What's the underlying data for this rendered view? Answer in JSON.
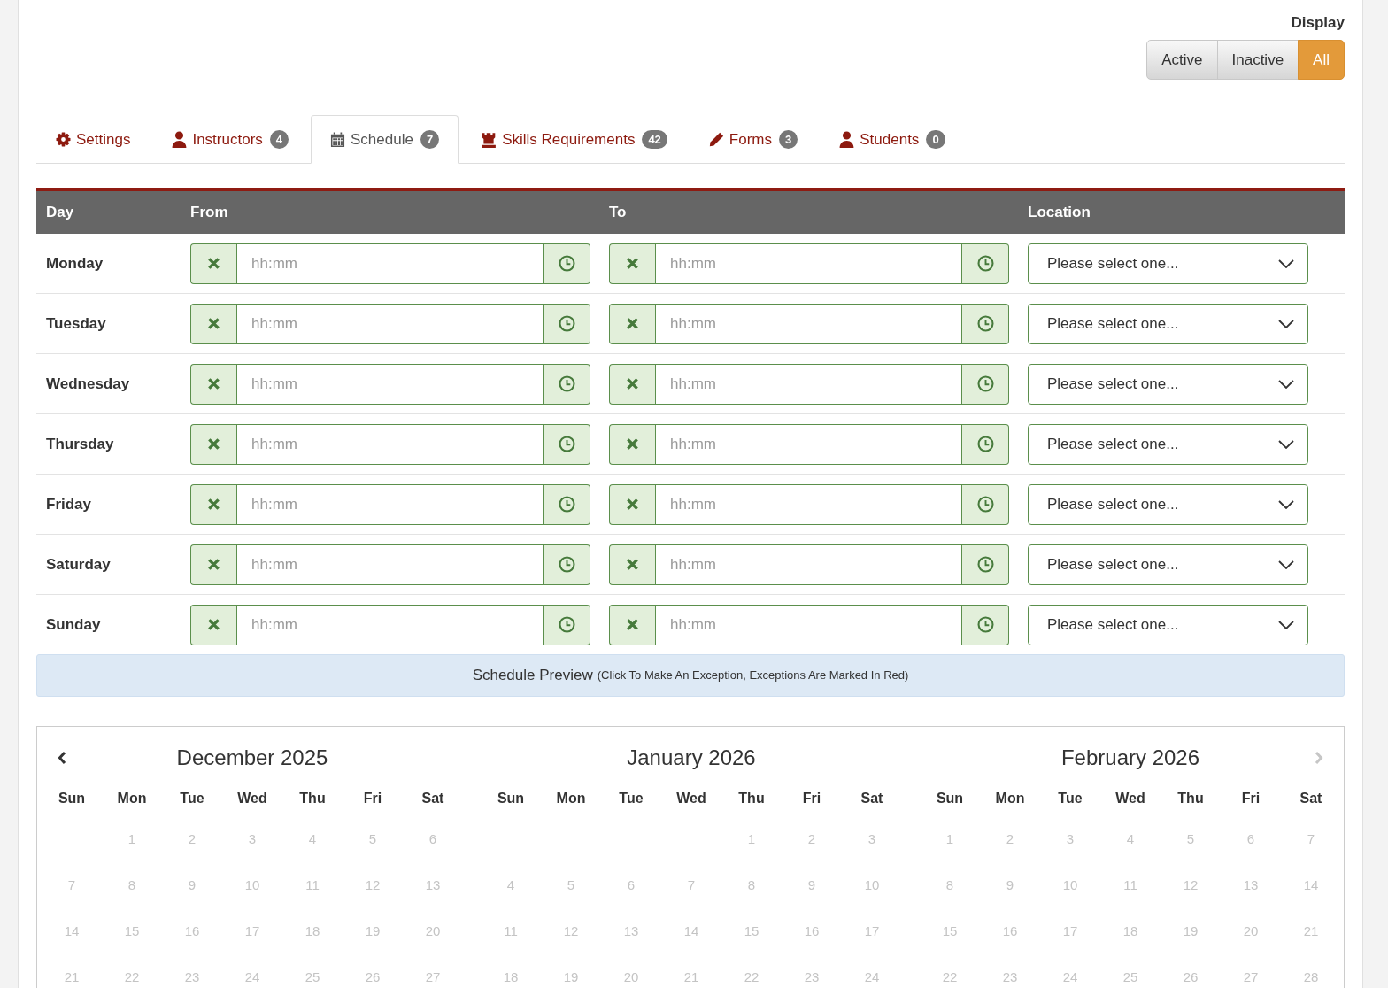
{
  "display": {
    "label": "Display",
    "options": [
      {
        "label": "Active",
        "selected": false
      },
      {
        "label": "Inactive",
        "selected": false
      },
      {
        "label": "All",
        "selected": true
      }
    ]
  },
  "tabs": [
    {
      "label": "Settings",
      "selected": false
    },
    {
      "label": "Instructors",
      "count": "4",
      "selected": false
    },
    {
      "label": "Schedule",
      "count": "7",
      "selected": true
    },
    {
      "label": "Skills Requirements",
      "count": "42",
      "selected": false
    },
    {
      "label": "Forms",
      "count": "3",
      "selected": false
    },
    {
      "label": "Students",
      "count": "0",
      "selected": false
    }
  ],
  "schedule": {
    "columns": [
      "Day",
      "From",
      "To",
      "Location"
    ],
    "rows": [
      {
        "day": "Monday",
        "from": {
          "placeholder": "hh:mm"
        },
        "to": {
          "placeholder": "hh:mm"
        },
        "location": "Please select one..."
      },
      {
        "day": "Tuesday",
        "from": {
          "placeholder": "hh:mm"
        },
        "to": {
          "placeholder": "hh:mm"
        },
        "location": "Please select one..."
      },
      {
        "day": "Wednesday",
        "from": {
          "placeholder": "hh:mm"
        },
        "to": {
          "placeholder": "hh:mm"
        },
        "location": "Please select one..."
      },
      {
        "day": "Thursday",
        "from": {
          "placeholder": "hh:mm"
        },
        "to": {
          "placeholder": "hh:mm"
        },
        "location": "Please select one..."
      },
      {
        "day": "Friday",
        "from": {
          "placeholder": "hh:mm"
        },
        "to": {
          "placeholder": "hh:mm"
        },
        "location": "Please select one..."
      },
      {
        "day": "Saturday",
        "from": {
          "placeholder": "hh:mm"
        },
        "to": {
          "placeholder": "hh:mm"
        },
        "location": "Please select one..."
      },
      {
        "day": "Sunday",
        "from": {
          "placeholder": "hh:mm"
        },
        "to": {
          "placeholder": "hh:mm"
        },
        "location": "Please select one..."
      }
    ]
  },
  "preview": {
    "title": "Schedule Preview",
    "note": "(Click To Make An Exception, Exceptions Are Marked In Red)"
  },
  "calendar": {
    "previous": {
      "disabled": false
    },
    "next": {
      "disabled": true
    },
    "months": [
      {
        "title": "December 2025",
        "weekdays": [
          "Sun",
          "Mon",
          "Tue",
          "Wed",
          "Thu",
          "Fri",
          "Sat"
        ],
        "weeks": [
          [
            {
              "kind": "blank"
            },
            {
              "kind": "day",
              "text": "1"
            },
            {
              "kind": "day",
              "text": "2"
            },
            {
              "kind": "day",
              "text": "3"
            },
            {
              "kind": "day",
              "text": "4"
            },
            {
              "kind": "day",
              "text": "5"
            },
            {
              "kind": "day",
              "text": "6"
            }
          ],
          [
            {
              "kind": "day",
              "text": "7"
            },
            {
              "kind": "day",
              "text": "8"
            },
            {
              "kind": "day",
              "text": "9"
            },
            {
              "kind": "day",
              "text": "10"
            },
            {
              "kind": "day",
              "text": "11"
            },
            {
              "kind": "day",
              "text": "12"
            },
            {
              "kind": "day",
              "text": "13"
            }
          ],
          [
            {
              "kind": "day",
              "text": "14"
            },
            {
              "kind": "day",
              "text": "15"
            },
            {
              "kind": "day",
              "text": "16"
            },
            {
              "kind": "day",
              "text": "17"
            },
            {
              "kind": "day",
              "text": "18"
            },
            {
              "kind": "day",
              "text": "19"
            },
            {
              "kind": "day",
              "text": "20"
            }
          ],
          [
            {
              "kind": "day",
              "text": "21"
            },
            {
              "kind": "day",
              "text": "22"
            },
            {
              "kind": "day",
              "text": "23"
            },
            {
              "kind": "day",
              "text": "24"
            },
            {
              "kind": "day",
              "text": "25"
            },
            {
              "kind": "day",
              "text": "26"
            },
            {
              "kind": "day",
              "text": "27"
            }
          ]
        ]
      },
      {
        "title": "January 2026",
        "weekdays": [
          "Sun",
          "Mon",
          "Tue",
          "Wed",
          "Thu",
          "Fri",
          "Sat"
        ],
        "weeks": [
          [
            {
              "kind": "blank"
            },
            {
              "kind": "blank"
            },
            {
              "kind": "blank"
            },
            {
              "kind": "blank"
            },
            {
              "kind": "day",
              "text": "1"
            },
            {
              "kind": "day",
              "text": "2"
            },
            {
              "kind": "day",
              "text": "3"
            }
          ],
          [
            {
              "kind": "day",
              "text": "4"
            },
            {
              "kind": "day",
              "text": "5"
            },
            {
              "kind": "day",
              "text": "6"
            },
            {
              "kind": "day",
              "text": "7"
            },
            {
              "kind": "day",
              "text": "8"
            },
            {
              "kind": "day",
              "text": "9"
            },
            {
              "kind": "day",
              "text": "10"
            }
          ],
          [
            {
              "kind": "day",
              "text": "11"
            },
            {
              "kind": "day",
              "text": "12"
            },
            {
              "kind": "day",
              "text": "13"
            },
            {
              "kind": "day",
              "text": "14"
            },
            {
              "kind": "day",
              "text": "15"
            },
            {
              "kind": "day",
              "text": "16"
            },
            {
              "kind": "day",
              "text": "17"
            }
          ],
          [
            {
              "kind": "day",
              "text": "18"
            },
            {
              "kind": "day",
              "text": "19"
            },
            {
              "kind": "day",
              "text": "20"
            },
            {
              "kind": "day",
              "text": "21"
            },
            {
              "kind": "day",
              "text": "22"
            },
            {
              "kind": "day",
              "text": "23"
            },
            {
              "kind": "day",
              "text": "24"
            }
          ]
        ]
      },
      {
        "title": "February 2026",
        "weekdays": [
          "Sun",
          "Mon",
          "Tue",
          "Wed",
          "Thu",
          "Fri",
          "Sat"
        ],
        "weeks": [
          [
            {
              "kind": "day",
              "text": "1"
            },
            {
              "kind": "day",
              "text": "2"
            },
            {
              "kind": "day",
              "text": "3"
            },
            {
              "kind": "day",
              "text": "4"
            },
            {
              "kind": "day",
              "text": "5"
            },
            {
              "kind": "day",
              "text": "6"
            },
            {
              "kind": "day",
              "text": "7"
            }
          ],
          [
            {
              "kind": "day",
              "text": "8"
            },
            {
              "kind": "day",
              "text": "9"
            },
            {
              "kind": "day",
              "text": "10"
            },
            {
              "kind": "day",
              "text": "11"
            },
            {
              "kind": "day",
              "text": "12"
            },
            {
              "kind": "day",
              "text": "13"
            },
            {
              "kind": "day",
              "text": "14"
            }
          ],
          [
            {
              "kind": "day",
              "text": "15"
            },
            {
              "kind": "day",
              "text": "16"
            },
            {
              "kind": "day",
              "text": "17"
            },
            {
              "kind": "day",
              "text": "18"
            },
            {
              "kind": "day",
              "text": "19"
            },
            {
              "kind": "day",
              "text": "20"
            },
            {
              "kind": "day",
              "text": "21"
            }
          ],
          [
            {
              "kind": "day",
              "text": "22"
            },
            {
              "kind": "day",
              "text": "23"
            },
            {
              "kind": "day",
              "text": "24"
            },
            {
              "kind": "day",
              "text": "25"
            },
            {
              "kind": "day",
              "text": "26"
            },
            {
              "kind": "day",
              "text": "27"
            },
            {
              "kind": "day",
              "text": "28"
            }
          ]
        ]
      }
    ]
  }
}
